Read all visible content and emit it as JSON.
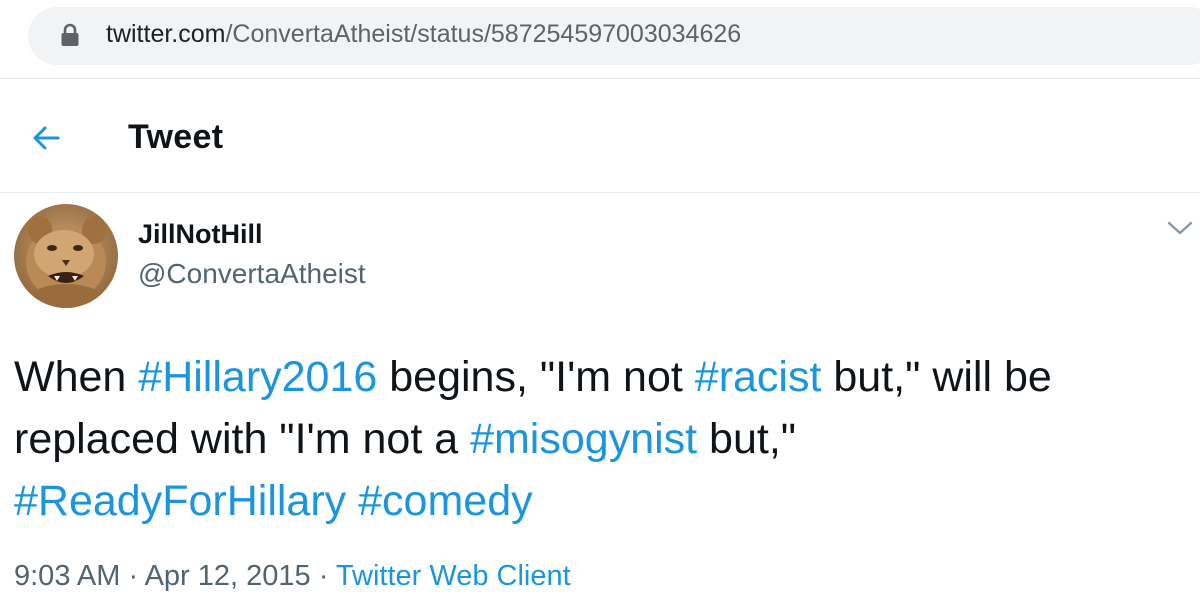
{
  "browser": {
    "url_host": "twitter.com",
    "url_path": "/ConvertaAtheist/status/587254597003034626"
  },
  "header": {
    "title": "Tweet"
  },
  "tweet": {
    "display_name": "JillNotHill",
    "handle": "@ConvertaAtheist",
    "text_parts": {
      "p1": "When ",
      "h1": "#Hillary2016",
      "p2": " begins, \"I'm not ",
      "h2": "#racist",
      "p3": " but,\" will be replaced with \"I'm not a ",
      "h3": "#misogynist",
      "p4": " but,\" ",
      "h4": "#ReadyForHillary",
      "p5": " ",
      "h5": "#comedy"
    },
    "time": "9:03 AM",
    "sep1": " · ",
    "date": "Apr 12, 2015",
    "sep2": " · ",
    "client": "Twitter Web Client"
  },
  "colors": {
    "accent": "#1b95e0",
    "text": "#0f1419",
    "secondary": "#536471"
  },
  "icons": {
    "lock": "lock-icon",
    "back": "back-arrow-icon",
    "caret": "chevron-down-icon",
    "avatar": "lion-cub-avatar"
  }
}
